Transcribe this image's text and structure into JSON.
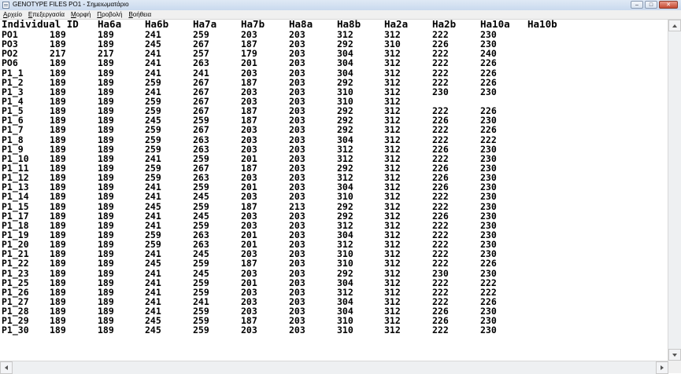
{
  "window": {
    "title": "GENOTYPE FILES PO1 - Σημειωματάριο",
    "buttons": {
      "minimize": "–",
      "maximize": "□",
      "close": "✕"
    }
  },
  "menu": [
    {
      "u": "Α",
      "rest": "ρχείο"
    },
    {
      "u": "Ε",
      "rest": "πεξεργασία"
    },
    {
      "u": "Μ",
      "rest": "ορφή"
    },
    {
      "u": "Π",
      "rest": "ροβολή"
    },
    {
      "u": "Β",
      "rest": "οήθεια"
    }
  ],
  "table": {
    "headers": [
      "Individual ID",
      "Ha6a",
      "Ha6b",
      "Ha7a",
      "Ha7b",
      "Ha8a",
      "Ha8b",
      "Ha2a",
      "Ha2b",
      "Ha10a",
      "Ha10b"
    ],
    "rows": [
      [
        "PO1",
        "189",
        "189",
        "241",
        "259",
        "203",
        "203",
        "312",
        "312",
        "222",
        "230"
      ],
      [
        "PO3",
        "189",
        "189",
        "245",
        "267",
        "187",
        "203",
        "292",
        "310",
        "226",
        "230"
      ],
      [
        "PO2",
        "217",
        "217",
        "241",
        "257",
        "179",
        "203",
        "304",
        "312",
        "222",
        "240"
      ],
      [
        "PO6",
        "189",
        "189",
        "241",
        "263",
        "201",
        "203",
        "304",
        "312",
        "222",
        "226"
      ],
      [
        "P1_1",
        "189",
        "189",
        "241",
        "241",
        "203",
        "203",
        "304",
        "312",
        "222",
        "226"
      ],
      [
        "P1_2",
        "189",
        "189",
        "259",
        "267",
        "187",
        "203",
        "292",
        "312",
        "222",
        "226"
      ],
      [
        "P1_3",
        "189",
        "189",
        "241",
        "267",
        "203",
        "203",
        "310",
        "312",
        "230",
        "230"
      ],
      [
        "P1_4",
        "189",
        "189",
        "259",
        "267",
        "203",
        "203",
        "310",
        "312",
        "",
        ""
      ],
      [
        "P1_5",
        "189",
        "189",
        "259",
        "267",
        "187",
        "203",
        "292",
        "312",
        "222",
        "226"
      ],
      [
        "P1_6",
        "189",
        "189",
        "245",
        "259",
        "187",
        "203",
        "292",
        "312",
        "226",
        "230"
      ],
      [
        "P1_7",
        "189",
        "189",
        "259",
        "267",
        "203",
        "203",
        "292",
        "312",
        "222",
        "226"
      ],
      [
        "P1_8",
        "189",
        "189",
        "259",
        "263",
        "203",
        "203",
        "304",
        "312",
        "222",
        "222"
      ],
      [
        "P1_9",
        "189",
        "189",
        "259",
        "263",
        "203",
        "203",
        "312",
        "312",
        "226",
        "230"
      ],
      [
        "P1_10",
        "189",
        "189",
        "241",
        "259",
        "201",
        "203",
        "312",
        "312",
        "222",
        "230"
      ],
      [
        "P1_11",
        "189",
        "189",
        "259",
        "267",
        "187",
        "203",
        "292",
        "312",
        "226",
        "230"
      ],
      [
        "P1_12",
        "189",
        "189",
        "259",
        "263",
        "203",
        "203",
        "312",
        "312",
        "226",
        "230"
      ],
      [
        "P1_13",
        "189",
        "189",
        "241",
        "259",
        "201",
        "203",
        "304",
        "312",
        "226",
        "230"
      ],
      [
        "P1_14",
        "189",
        "189",
        "241",
        "245",
        "203",
        "203",
        "310",
        "312",
        "222",
        "230"
      ],
      [
        "P1_15",
        "189",
        "189",
        "245",
        "259",
        "187",
        "213",
        "292",
        "312",
        "222",
        "230"
      ],
      [
        "P1_17",
        "189",
        "189",
        "241",
        "245",
        "203",
        "203",
        "292",
        "312",
        "226",
        "230"
      ],
      [
        "P1_18",
        "189",
        "189",
        "241",
        "259",
        "203",
        "203",
        "312",
        "312",
        "222",
        "230"
      ],
      [
        "P1_19",
        "189",
        "189",
        "259",
        "263",
        "201",
        "203",
        "304",
        "312",
        "222",
        "230"
      ],
      [
        "P1_20",
        "189",
        "189",
        "259",
        "263",
        "201",
        "203",
        "312",
        "312",
        "222",
        "230"
      ],
      [
        "P1_21",
        "189",
        "189",
        "241",
        "245",
        "203",
        "203",
        "310",
        "312",
        "222",
        "230"
      ],
      [
        "P1_22",
        "189",
        "189",
        "245",
        "259",
        "187",
        "203",
        "310",
        "312",
        "222",
        "226"
      ],
      [
        "P1_23",
        "189",
        "189",
        "241",
        "245",
        "203",
        "203",
        "292",
        "312",
        "230",
        "230"
      ],
      [
        "P1_25",
        "189",
        "189",
        "241",
        "259",
        "201",
        "203",
        "304",
        "312",
        "222",
        "222"
      ],
      [
        "P1_26",
        "189",
        "189",
        "241",
        "259",
        "203",
        "203",
        "312",
        "312",
        "222",
        "222"
      ],
      [
        "P1_27",
        "189",
        "189",
        "241",
        "241",
        "203",
        "203",
        "304",
        "312",
        "222",
        "226"
      ],
      [
        "P1_28",
        "189",
        "189",
        "241",
        "259",
        "203",
        "203",
        "304",
        "312",
        "226",
        "230"
      ],
      [
        "P1_29",
        "189",
        "189",
        "245",
        "259",
        "187",
        "203",
        "310",
        "312",
        "226",
        "230"
      ],
      [
        "P1_30",
        "189",
        "189",
        "245",
        "259",
        "203",
        "203",
        "310",
        "312",
        "222",
        "230"
      ]
    ]
  }
}
